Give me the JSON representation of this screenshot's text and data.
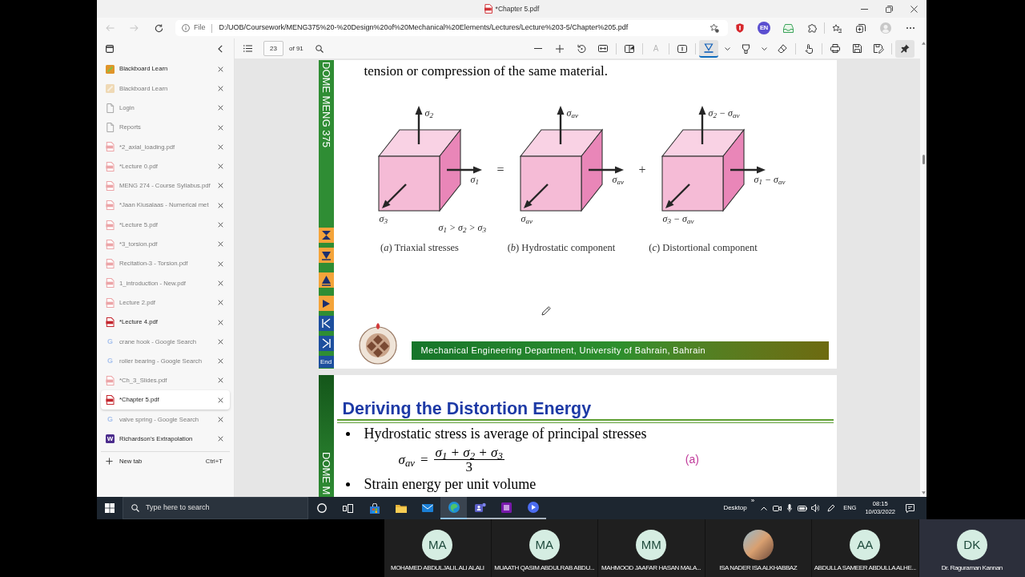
{
  "window": {
    "title": "*Chapter 5.pdf"
  },
  "navigation": [
    {
      "kind": "back",
      "disabled": true
    },
    {
      "kind": "forward",
      "disabled": true
    },
    {
      "kind": "refresh",
      "disabled": false
    }
  ],
  "address_bar": {
    "scheme": "File",
    "url": "D:/UOB/Coursework/MENG375%20-%20Design%20of%20Mechanical%20Elements/Lectures/Lecture%203-5/Chapter%205.pdf"
  },
  "extension_badge": "EN",
  "vertical_tabs": {
    "items": [
      {
        "title": "Blackboard Learn",
        "kind": "blackboard",
        "faded": false,
        "selected": false
      },
      {
        "title": "Blackboard Learn",
        "kind": "blackboard",
        "faded": true,
        "selected": false
      },
      {
        "title": "Login",
        "kind": "page",
        "faded": true,
        "selected": false
      },
      {
        "title": "Reports",
        "kind": "page",
        "faded": true,
        "selected": false
      },
      {
        "title": "*2_axial_loading.pdf",
        "kind": "pdf",
        "faded": true,
        "selected": false
      },
      {
        "title": "*Lecture 0.pdf",
        "kind": "pdf",
        "faded": true,
        "selected": false
      },
      {
        "title": "MENG 274 - Course Syllabus.pdf",
        "kind": "pdf",
        "faded": true,
        "selected": false
      },
      {
        "title": "*Jaan Kiusalaas - Numerical met",
        "kind": "pdf",
        "faded": true,
        "selected": false
      },
      {
        "title": "*Lecture 5.pdf",
        "kind": "pdf",
        "faded": true,
        "selected": false
      },
      {
        "title": "*3_torsion.pdf",
        "kind": "pdf",
        "faded": true,
        "selected": false
      },
      {
        "title": "Recitation-3 - Torsion.pdf",
        "kind": "pdf",
        "faded": true,
        "selected": false
      },
      {
        "title": "1_introduction - New.pdf",
        "kind": "pdf",
        "faded": true,
        "selected": false
      },
      {
        "title": "Lecture 2.pdf",
        "kind": "pdf",
        "faded": true,
        "selected": false
      },
      {
        "title": "*Lecture 4.pdf",
        "kind": "pdf",
        "faded": false,
        "selected": false
      },
      {
        "title": "crane hook - Google Search",
        "kind": "google",
        "icon_text": "G",
        "faded": true,
        "selected": false
      },
      {
        "title": "roller bearing - Google Search",
        "kind": "google",
        "icon_text": "G",
        "faded": true,
        "selected": false
      },
      {
        "title": "*Ch_3_Slides.pdf",
        "kind": "pdf",
        "faded": true,
        "selected": false
      },
      {
        "title": "*Chapter 5.pdf",
        "kind": "pdf",
        "faded": false,
        "selected": true
      },
      {
        "title": "valve spring - Google Search",
        "kind": "google",
        "icon_text": "G",
        "faded": true,
        "selected": false
      },
      {
        "title": "Richardson's Extrapolation",
        "kind": "word",
        "icon_text": "W",
        "faded": false,
        "selected": false
      }
    ],
    "new_tab": {
      "label": "New tab",
      "shortcut": "Ctrl+T"
    }
  },
  "pdf_toolbar": {
    "page": "23",
    "page_count": "of 91",
    "tool_groups": [
      [
        {
          "kind": "zoom_out",
          "selected": false,
          "disabled": false
        },
        {
          "kind": "zoom_in",
          "selected": false,
          "disabled": false
        },
        {
          "kind": "rotate",
          "selected": false,
          "disabled": false
        },
        {
          "kind": "fit_page",
          "selected": false,
          "disabled": false
        }
      ],
      [
        {
          "kind": "page_view",
          "selected": false,
          "disabled": false
        }
      ],
      [
        {
          "kind": "read_aloud",
          "text": "A",
          "selected": false,
          "disabled": true
        }
      ],
      [
        {
          "kind": "text",
          "selected": false,
          "disabled": false
        }
      ],
      [
        {
          "kind": "draw",
          "selected": true,
          "disabled": false
        },
        {
          "kind": "draw_menu",
          "selected": false,
          "disabled": false
        },
        {
          "kind": "highlight",
          "selected": false,
          "disabled": false
        },
        {
          "kind": "highlight_menu",
          "selected": false,
          "disabled": false
        },
        {
          "kind": "erase",
          "selected": false,
          "disabled": false
        }
      ],
      [
        {
          "kind": "touch",
          "selected": false,
          "disabled": false
        }
      ],
      [
        {
          "kind": "print",
          "selected": false,
          "disabled": false
        },
        {
          "kind": "save",
          "selected": false,
          "disabled": false
        },
        {
          "kind": "save_as",
          "selected": false,
          "disabled": false
        }
      ],
      [
        {
          "kind": "pin",
          "selected": true,
          "disabled": false
        }
      ]
    ]
  },
  "document": {
    "figure_page": {
      "side_label": "DOME MENG 375",
      "end_label": "End",
      "text": "tension or compression of the same material.",
      "figure": {
        "panels": [
          {
            "top": "σ$_{2}$",
            "right": "σ$_{1}$",
            "bottom": "σ$_{3}$",
            "relation": "σ$_{1}$ > σ$_{2}$ > σ$_{3}$",
            "caption": "(*a*) Triaxial stresses"
          },
          {
            "top": "σ$_{av}$",
            "right": "σ$_{av}$",
            "bottom": "σ$_{av}$",
            "caption": "(*b*) Hydrostatic component"
          },
          {
            "top": "σ$_{2}$ − σ$_{av}$",
            "right": "σ$_{1}$ − σ$_{av}$",
            "bottom": "σ$_{3}$ − σ$_{av}$",
            "caption": "(*c*) Distortional component"
          }
        ],
        "operators": [
          "=",
          "+"
        ]
      },
      "footer": "Mechanical Engineering Department, University of Bahrain, Bahrain"
    },
    "text_page": {
      "side_label": "DOME M",
      "title": "Deriving the Distortion Energy",
      "body": [
        {
          "kind": "bullet",
          "text": "Hydrostatic stress is average of principal stresses"
        },
        {
          "kind": "equation",
          "lhs": "σ$_{av}$",
          "equals": "=",
          "numerator": "σ$_{1}$ + σ$_{2}$ + σ$_{3}$",
          "denominator": "3",
          "tag": "(a)"
        },
        {
          "kind": "bullet",
          "text": "Strain energy per unit volume"
        }
      ]
    }
  },
  "taskbar": {
    "search_placeholder": "Type here to search",
    "apps": [
      {
        "kind": "cortana",
        "active": false,
        "running": false
      },
      {
        "kind": "task_view",
        "active": false,
        "running": false
      },
      {
        "kind": "store",
        "active": false,
        "running": false
      },
      {
        "kind": "explorer",
        "active": false,
        "running": false
      },
      {
        "kind": "mail",
        "active": false,
        "running": false
      },
      {
        "kind": "edge",
        "active": true,
        "running": true
      },
      {
        "kind": "teams",
        "active": false,
        "running": true
      },
      {
        "kind": "onenote",
        "active": false,
        "running": true
      },
      {
        "kind": "other",
        "active": false,
        "running": true
      }
    ],
    "tray": {
      "desktop": "Desktop",
      "overflow": "»",
      "language": "ENG",
      "time": "08:15",
      "date": "10/03/2022"
    }
  },
  "meeting": {
    "participants": [
      {
        "name": "MOHAMED ABDULJALIL ALI ALALI",
        "kind": "initials",
        "initials": "MA",
        "highlighted": false
      },
      {
        "name": "MUAATH QASIM ABDULRAB ABDU...",
        "kind": "initials",
        "initials": "MA",
        "highlighted": false
      },
      {
        "name": "MAHMOOD JAAFAR HASAN MALA...",
        "kind": "initials",
        "initials": "MM",
        "highlighted": false
      },
      {
        "name": "ISA NADER ISA ALKHABBAZ",
        "kind": "picture",
        "highlighted": false
      },
      {
        "name": "ABDULLA SAMEER ABDULLA ALHE...",
        "kind": "initials",
        "initials": "AA",
        "highlighted": false
      },
      {
        "name": "Dr. Raguraman Kannan",
        "kind": "initials",
        "initials": "DK",
        "highlighted": true
      }
    ]
  }
}
